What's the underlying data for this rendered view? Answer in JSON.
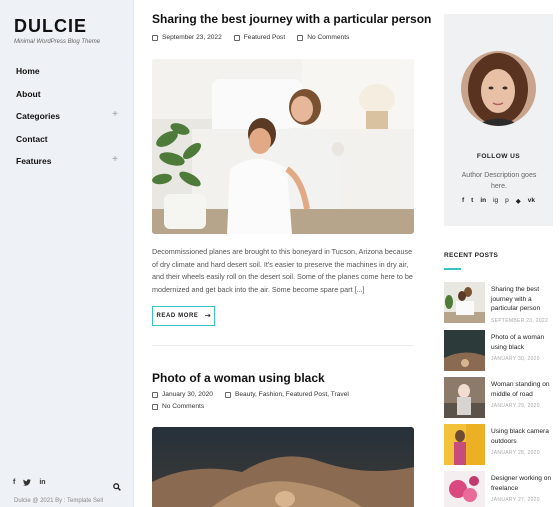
{
  "site": {
    "brand": "DULCIE",
    "tagline": "Minimal WordPress Blog Theme",
    "copyright": "Dulcie @ 2021 By : Template Sell"
  },
  "nav": {
    "items": [
      {
        "label": "Home",
        "expandable": false
      },
      {
        "label": "About",
        "expandable": false
      },
      {
        "label": "Categories",
        "expandable": true
      },
      {
        "label": "Contact",
        "expandable": false
      },
      {
        "label": "Features",
        "expandable": true
      }
    ],
    "plus": "+"
  },
  "sidebar_social": [
    "f",
    "t",
    "in"
  ],
  "posts": [
    {
      "title": "Sharing the best journey with a particular person",
      "date": "September 23, 2022",
      "category": "Featured Post",
      "comments": "No Comments",
      "excerpt": "Decommissioned planes are brought to this boneyard in Tucson, Arizona because of dry climate and hard desert soil. It's easier to preserve the machines in dry air, and their wheels easily roll on the desert soil. Some of the planes come here to be modernized and get back into the air. Some become spare part [...]",
      "read_more": "READ MORE"
    },
    {
      "title": "Photo of a woman using black",
      "date": "January 30, 2020",
      "category": "Beauty, Fashion, Featured Post, Travel",
      "comments": "No Comments"
    }
  ],
  "author": {
    "follow_label": "FOLLOW US",
    "description": "Author Description goes here.",
    "social": [
      "f",
      "t",
      "in",
      "ig",
      "p",
      "◆",
      "vk"
    ]
  },
  "recent": {
    "title": "RECENT POSTS",
    "items": [
      {
        "title": "Sharing the best journey with a particular person",
        "date": "SEPTEMBER 23, 2022"
      },
      {
        "title": "Photo of a woman using black",
        "date": "JANUARY 30, 2020"
      },
      {
        "title": "Woman standing on middle of road",
        "date": "JANUARY 29, 2020"
      },
      {
        "title": "Using black camera outdoors",
        "date": "JANUARY 28, 2020"
      },
      {
        "title": "Designer working on freelance",
        "date": "JANUARY 27, 2020"
      }
    ]
  },
  "colors": {
    "accent": "#37c3c2",
    "sidebar_bg": "#eef1f6",
    "widget_bg": "#f0f1f3"
  }
}
